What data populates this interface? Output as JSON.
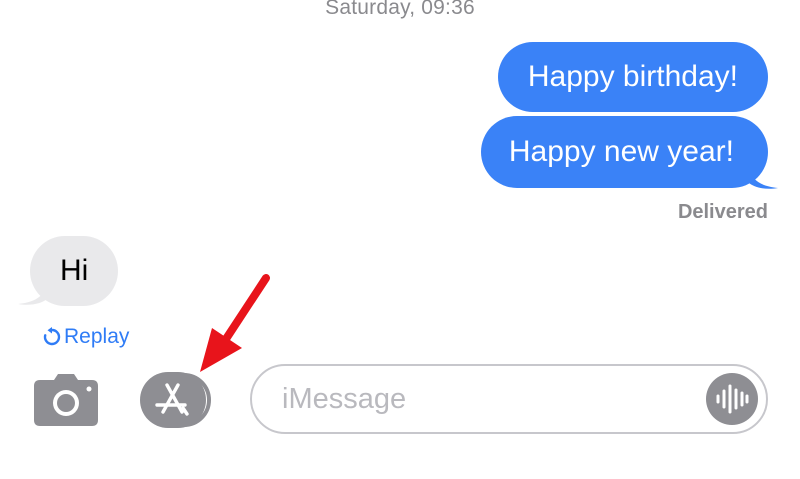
{
  "header": {
    "timestamp": "Saturday, 09:36"
  },
  "conversation": {
    "messages": [
      {
        "direction": "sent",
        "text": "Happy birthday!"
      },
      {
        "direction": "sent",
        "text": "Happy new year!"
      },
      {
        "direction": "received",
        "text": "Hi"
      }
    ],
    "status": "Delivered",
    "replay_label": "Replay"
  },
  "compose": {
    "placeholder": "iMessage",
    "value": ""
  },
  "icons": {
    "camera": "camera-icon",
    "apps": "app-store-icon",
    "audio": "audio-waveform-icon",
    "replay": "replay-icon",
    "annotation": "red-arrow-icon"
  },
  "colors": {
    "sent_bubble": "#3a82f7",
    "received_bubble": "#e9e9eb",
    "accent_link": "#2f7cf6",
    "secondary_text": "#8a8a8e",
    "icon_gray": "#8e8e93",
    "annotation_red": "#e8141b"
  }
}
